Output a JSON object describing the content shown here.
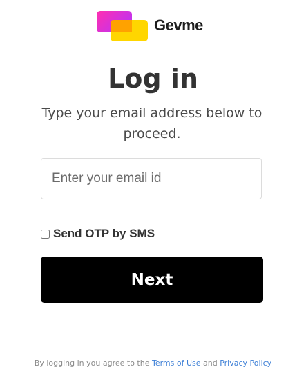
{
  "logo": {
    "brand_name": "Gevme",
    "colors": {
      "back_card_gradient": [
        "#ff2fb0",
        "#b234ff"
      ],
      "front_card": "#ffd600",
      "overlap": "#ffa200"
    }
  },
  "login": {
    "title": "Log in",
    "subtitle": "Type your email address below to proceed.",
    "email": {
      "value": "",
      "placeholder": "Enter your email id"
    },
    "otp": {
      "label": "Send OTP by SMS",
      "checked": false
    },
    "next_label": "Next"
  },
  "footer": {
    "prefix": "By logging in you agree to the ",
    "terms_label": "Terms of Use",
    "conjunction": " and ",
    "privacy_label": "Privacy Policy",
    "link_color": "#3d7fd6"
  }
}
